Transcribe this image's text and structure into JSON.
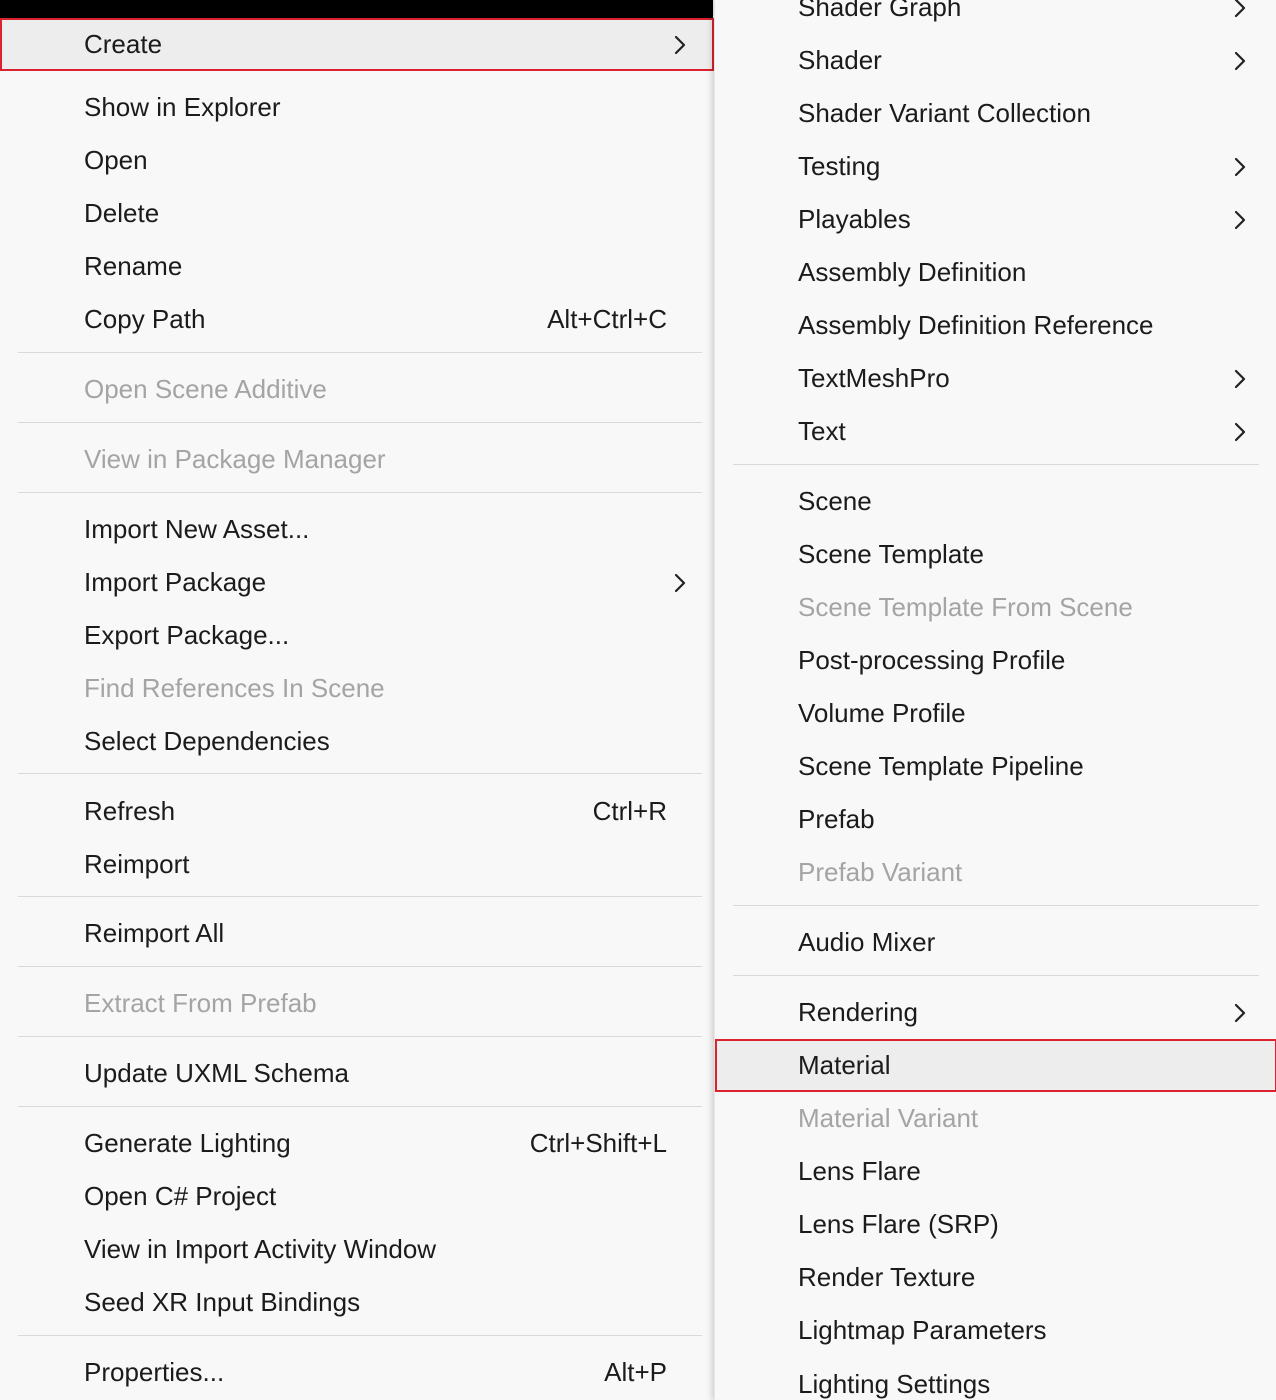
{
  "left_menu": {
    "items": [
      {
        "label": "Create",
        "submenu": true,
        "highlighted": true
      },
      {
        "label": "Show in Explorer"
      },
      {
        "label": "Open"
      },
      {
        "label": "Delete"
      },
      {
        "label": "Rename"
      },
      {
        "label": "Copy Path",
        "shortcut": "Alt+Ctrl+C"
      },
      {
        "label": "Open Scene Additive",
        "disabled": true
      },
      {
        "label": "View in Package Manager",
        "disabled": true
      },
      {
        "label": "Import New Asset..."
      },
      {
        "label": "Import Package",
        "submenu": true
      },
      {
        "label": "Export Package..."
      },
      {
        "label": "Find References In Scene",
        "disabled": true
      },
      {
        "label": "Select Dependencies"
      },
      {
        "label": "Refresh",
        "shortcut": "Ctrl+R"
      },
      {
        "label": "Reimport"
      },
      {
        "label": "Reimport All"
      },
      {
        "label": "Extract From Prefab",
        "disabled": true
      },
      {
        "label": "Update UXML Schema"
      },
      {
        "label": "Generate Lighting",
        "shortcut": "Ctrl+Shift+L"
      },
      {
        "label": "Open C# Project"
      },
      {
        "label": "View in Import Activity Window"
      },
      {
        "label": "Seed XR Input Bindings"
      },
      {
        "label": "Properties...",
        "shortcut": "Alt+P"
      }
    ]
  },
  "right_menu": {
    "items": [
      {
        "label": "Shader Graph",
        "submenu": true
      },
      {
        "label": "Shader",
        "submenu": true
      },
      {
        "label": "Shader Variant Collection"
      },
      {
        "label": "Testing",
        "submenu": true
      },
      {
        "label": "Playables",
        "submenu": true
      },
      {
        "label": "Assembly Definition"
      },
      {
        "label": "Assembly Definition Reference"
      },
      {
        "label": "TextMeshPro",
        "submenu": true
      },
      {
        "label": "Text",
        "submenu": true
      },
      {
        "label": "Scene"
      },
      {
        "label": "Scene Template"
      },
      {
        "label": "Scene Template From Scene",
        "disabled": true
      },
      {
        "label": "Post-processing Profile"
      },
      {
        "label": "Volume Profile"
      },
      {
        "label": "Scene Template Pipeline"
      },
      {
        "label": "Prefab"
      },
      {
        "label": "Prefab Variant",
        "disabled": true
      },
      {
        "label": "Audio Mixer"
      },
      {
        "label": "Rendering",
        "submenu": true
      },
      {
        "label": "Material",
        "highlighted": true
      },
      {
        "label": "Material Variant",
        "disabled": true
      },
      {
        "label": "Lens Flare"
      },
      {
        "label": "Lens Flare (SRP)"
      },
      {
        "label": "Render Texture"
      },
      {
        "label": "Lightmap Parameters"
      },
      {
        "label": "Lighting Settings"
      }
    ]
  },
  "colors": {
    "menu_bg": "#f8f8f8",
    "text": "#1b1b1b",
    "disabled_text": "#a4a4a4",
    "highlight_bg": "#ededed",
    "callout_outline": "#d9232e",
    "separator": "#d9d9d9"
  },
  "icons": {
    "submenu": "chevron-right-icon"
  }
}
